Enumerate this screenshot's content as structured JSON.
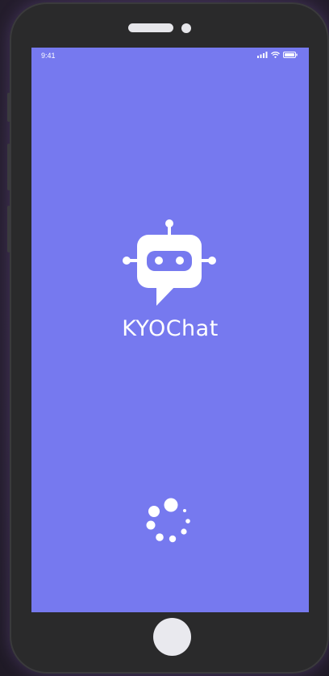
{
  "status_bar": {
    "time": "9:41",
    "signal_icon": "signal-bars-icon",
    "wifi_icon": "wifi-icon",
    "battery_icon": "battery-icon"
  },
  "splash": {
    "logo_icon": "robot-chat-icon",
    "app_name": "KYOChat",
    "loader_icon": "loading-spinner-icon"
  },
  "colors": {
    "screen_background": "#7679ef",
    "foreground": "#ffffff",
    "phone_frame": "#2a2a2b"
  }
}
